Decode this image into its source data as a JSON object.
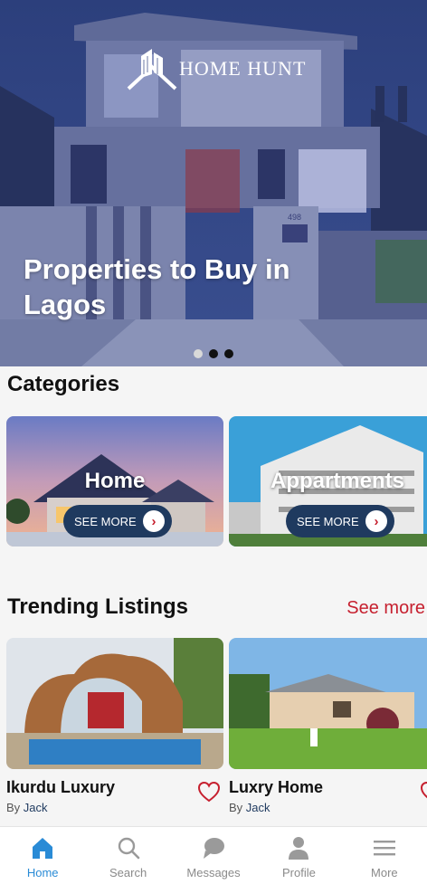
{
  "app": {
    "brand_name": "HOME HUNT"
  },
  "hero": {
    "title": "Properties to Buy in Lagos",
    "house_number": "498",
    "slides_total": 3,
    "active_slide": 1
  },
  "categories": {
    "title": "Categories",
    "items": [
      {
        "label": "Home",
        "button_label": "SEE MORE"
      },
      {
        "label": "Appartments",
        "button_label": "SEE MORE"
      }
    ]
  },
  "trending": {
    "title": "Trending Listings",
    "see_more_label": "See more",
    "listings": [
      {
        "title": "Ikurdu Luxury",
        "by_prefix": "By",
        "author": "Jack"
      },
      {
        "title": "Luxry Home",
        "by_prefix": "By",
        "author": "Jack"
      }
    ]
  },
  "bottom_nav": {
    "items": [
      {
        "label": "Home",
        "icon": "home-icon",
        "active": true
      },
      {
        "label": "Search",
        "icon": "search-icon",
        "active": false
      },
      {
        "label": "Messages",
        "icon": "chat-bubble-icon",
        "active": false
      },
      {
        "label": "Profile",
        "icon": "person-icon",
        "active": false
      },
      {
        "label": "More",
        "icon": "menu-icon",
        "active": false
      }
    ]
  },
  "colors": {
    "accent_red": "#c6202f",
    "nav_active_blue": "#2a8bd6",
    "button_navy": "#1f3a5f"
  }
}
